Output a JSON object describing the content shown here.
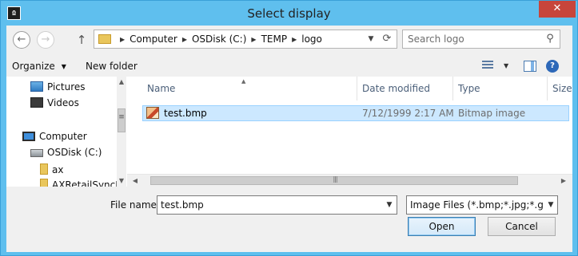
{
  "window": {
    "title": "Select display",
    "app_icon_text": "Ω",
    "close_glyph": "✕"
  },
  "nav": {
    "back_glyph": "←",
    "forward_glyph": "→",
    "up_glyph": "↑",
    "breadcrumbs": [
      "Computer",
      "OSDisk (C:)",
      "TEMP",
      "logo"
    ],
    "crumb_separator": "▶",
    "dropdown_glyph": "▼",
    "refresh_glyph": "⟳",
    "search_placeholder": "Search logo",
    "search_glyph": "⚲"
  },
  "toolbar": {
    "organize_label": "Organize",
    "organize_caret": "▼",
    "new_folder_label": "New folder",
    "view_caret": "▼",
    "help_glyph": "?"
  },
  "navpane": {
    "items": [
      {
        "label": "Pictures",
        "icon": "pictures-icon"
      },
      {
        "label": "Videos",
        "icon": "videos-icon"
      },
      {
        "label": "Computer",
        "icon": "computer-icon"
      },
      {
        "label": "OSDisk (C:)",
        "icon": "disk-icon"
      },
      {
        "label": "ax",
        "icon": "folder-icon"
      },
      {
        "label": "AXRetailSyncFr",
        "icon": "folder-icon"
      }
    ],
    "scroll_up_glyph": "▲",
    "scroll_down_glyph": "▼"
  },
  "filelist": {
    "columns": [
      "Name",
      "Date modified",
      "Type",
      "Size"
    ],
    "sort_glyph": "▲",
    "rows": [
      {
        "name": "test.bmp",
        "date": "7/12/1999 2:17 AM",
        "type": "Bitmap image",
        "size": "",
        "icon": "bitmap-icon",
        "selected": true
      }
    ],
    "scroll_left_glyph": "◀",
    "scroll_right_glyph": "▶"
  },
  "footer": {
    "file_name_label": "File name:",
    "file_name_value": "test.bmp",
    "file_type_value": "Image Files (*.bmp;*.jpg;*.gif;*.",
    "dropdown_glyph": "▼",
    "open_label": "Open",
    "cancel_label": "Cancel"
  },
  "colors": {
    "title_bar": "#5fbfee",
    "close_button": "#c7453b",
    "selection": "#cce8ff",
    "column_header_text": "#4c607a"
  }
}
